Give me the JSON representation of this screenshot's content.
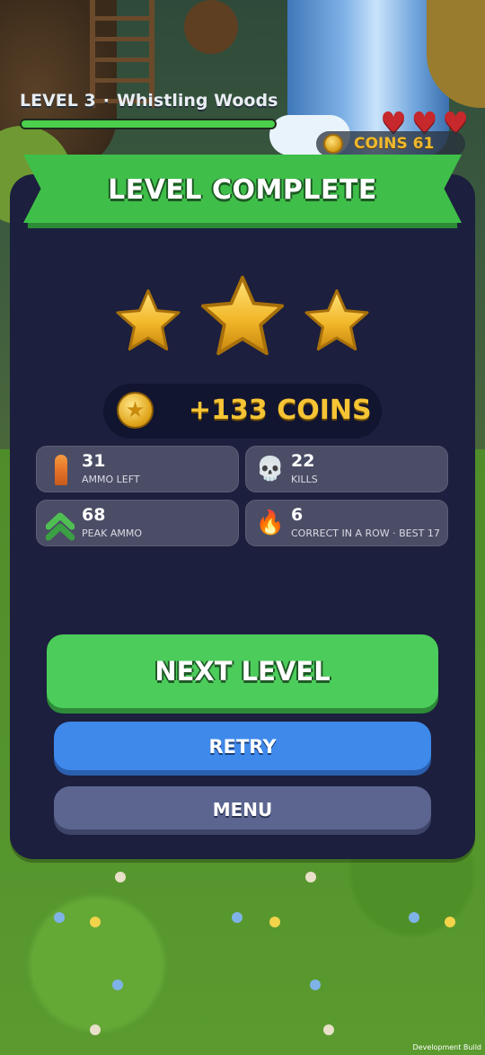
{
  "hud": {
    "level_label": "LEVEL 3",
    "separator": "·",
    "level_name": "Whistling Woods",
    "level_progress": 1.0,
    "hearts": 3,
    "coins_label": "COINS 61"
  },
  "panel": {
    "title": "LEVEL COMPLETE",
    "stars_earned": 3,
    "stars_total": 3,
    "reward_text": "+133 COINS"
  },
  "stats": [
    {
      "icon": "bullet-icon",
      "value": "31",
      "label": "AMMO LEFT"
    },
    {
      "icon": "skull-icon",
      "value": "22",
      "label": "KILLS"
    },
    {
      "icon": "chevrons-up-icon",
      "value": "68",
      "label": "PEAK AMMO"
    },
    {
      "icon": "fire-icon",
      "value": "6",
      "label": "CORRECT IN A ROW · BEST 17"
    }
  ],
  "buttons": {
    "next_level": "NEXT LEVEL",
    "retry": "RETRY",
    "menu": "MENU"
  },
  "footer": {
    "build_tag": "Development Build"
  },
  "colors": {
    "panel": "#1c1f3d",
    "ribbon": "#3fbf49",
    "next_button": "#4ccd5b",
    "retry_button": "#3e89ea",
    "menu_button": "#5b6590",
    "coin_gold": "#f6c434",
    "heart_red": "#c6282b"
  }
}
